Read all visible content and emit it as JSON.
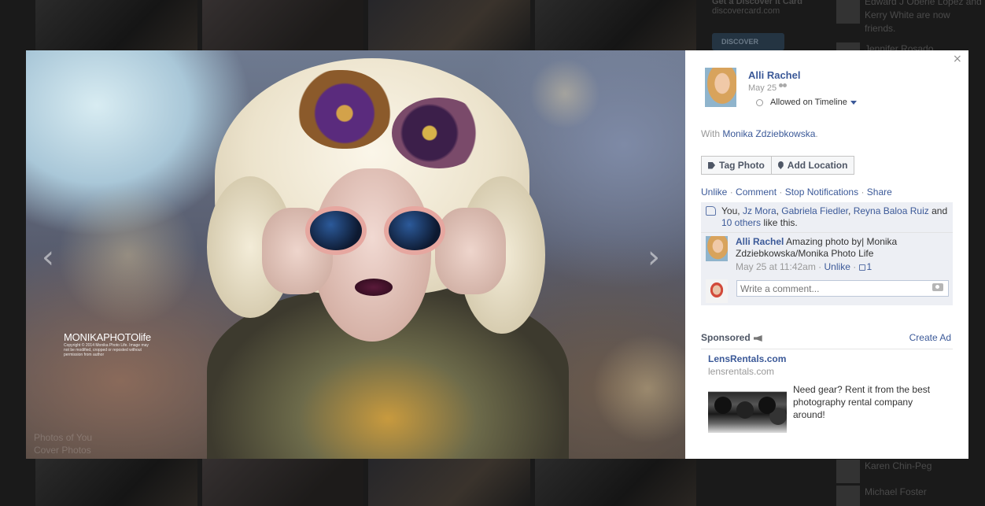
{
  "background": {
    "ad_text": "discovercard.com",
    "ad_text_top": "Get a Discover It Card",
    "ad_logo": "DISCOVER",
    "news_rows": [
      {
        "text": "Edward J Oberle Lopez and Kerry White are now friends."
      },
      {
        "text": "Jennifer Rosado"
      },
      {
        "text": "Karen Chin-Peg"
      },
      {
        "text": "Michael Foster"
      }
    ],
    "faded_lines": [
      "Photos of You",
      "Cover Photos"
    ]
  },
  "photo": {
    "watermark_brand": "MONIKAPHOTOlife",
    "watermark_small": "Copyright © 2014 Monika Photo Life. Image may not be modified, cropped or reposted without permission from author",
    "prev_label": "‹",
    "next_label": "›"
  },
  "sidebar": {
    "close_label": "×",
    "author_name": "Alli Rachel",
    "post_date": "May 25",
    "timeline_status": "Allowed on Timeline",
    "with_prefix": "With",
    "with_person": "Monika Zdziebkowska",
    "with_suffix": ".",
    "buttons": {
      "tag_photo": "Tag Photo",
      "add_location": "Add Location"
    },
    "actions": {
      "unlike": "Unlike",
      "comment": "Comment",
      "stop_notifications": "Stop Notifications",
      "share": "Share",
      "sep": " · "
    },
    "likes": {
      "you": "You,",
      "people": [
        "Jz Mora",
        "Gabriela Fiedler",
        "Reyna Baloa Ruiz"
      ],
      "and": "and",
      "others": "10 others",
      "tail": "like this."
    },
    "comment": {
      "author": "Alli Rachel",
      "text": "Amazing photo by| Monika Zdziebkowska/Monika Photo Life",
      "time": "May 25 at 11:42am",
      "unlike": "Unlike",
      "like_count": "1"
    },
    "write_comment_placeholder": "Write a comment...",
    "sponsored": {
      "label": "Sponsored",
      "create_ad": "Create Ad",
      "ad_title": "LensRentals.com",
      "ad_domain": "lensrentals.com",
      "ad_body": "Need gear? Rent it from the best photography rental company around!"
    }
  },
  "colors": {
    "link": "#3b5998",
    "meta": "#999999",
    "panel": "#edeff4"
  }
}
